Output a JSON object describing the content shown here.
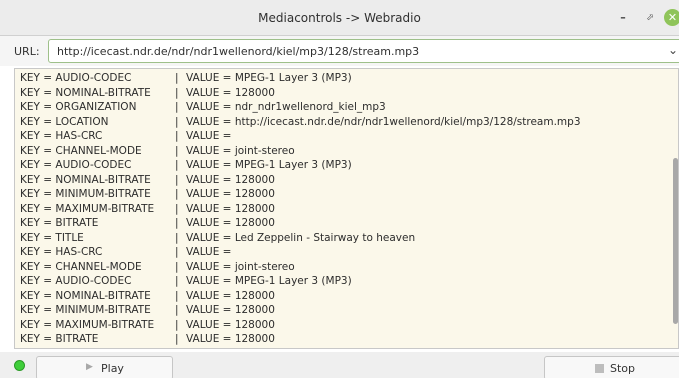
{
  "window": {
    "title": "Mediacontrols -> Webradio",
    "minimize_glyph": "–",
    "maximize_glyph": "⬀",
    "close_glyph": "⊗"
  },
  "url_bar": {
    "label": "URL:",
    "value": "http://icecast.ndr.de/ndr/ndr1wellenord/kiel/mp3/128/stream.mp3",
    "dropdown_glyph": "⌄"
  },
  "metadata": {
    "separator": "|",
    "rows": [
      {
        "key": "KEY = AUDIO-CODEC",
        "value": "VALUE = MPEG-1 Layer 3 (MP3)"
      },
      {
        "key": "KEY = NOMINAL-BITRATE",
        "value": "VALUE = 128000"
      },
      {
        "key": "KEY = ORGANIZATION",
        "value": "VALUE = ndr_ndr1wellenord_kiel_mp3"
      },
      {
        "key": "KEY = LOCATION",
        "value": "VALUE = http://icecast.ndr.de/ndr/ndr1wellenord/kiel/mp3/128/stream.mp3"
      },
      {
        "key": "KEY = HAS-CRC",
        "value": "VALUE ="
      },
      {
        "key": "KEY = CHANNEL-MODE",
        "value": "VALUE = joint-stereo"
      },
      {
        "key": "KEY = AUDIO-CODEC",
        "value": "VALUE = MPEG-1 Layer 3 (MP3)"
      },
      {
        "key": "KEY = NOMINAL-BITRATE",
        "value": "VALUE = 128000"
      },
      {
        "key": "KEY = MINIMUM-BITRATE",
        "value": "VALUE = 128000"
      },
      {
        "key": "KEY = MAXIMUM-BITRATE",
        "value": "VALUE = 128000"
      },
      {
        "key": "KEY = BITRATE",
        "value": "VALUE = 128000"
      },
      {
        "key": "KEY = TITLE",
        "value": "VALUE = Led Zeppelin - Stairway to heaven"
      },
      {
        "key": "KEY = HAS-CRC",
        "value": "VALUE ="
      },
      {
        "key": "KEY = CHANNEL-MODE",
        "value": "VALUE = joint-stereo"
      },
      {
        "key": "KEY = AUDIO-CODEC",
        "value": "VALUE = MPEG-1 Layer 3 (MP3)"
      },
      {
        "key": "KEY = NOMINAL-BITRATE",
        "value": "VALUE = 128000"
      },
      {
        "key": "KEY = MINIMUM-BITRATE",
        "value": "VALUE = 128000"
      },
      {
        "key": "KEY = MAXIMUM-BITRATE",
        "value": "VALUE = 128000"
      },
      {
        "key": "KEY = BITRATE",
        "value": "VALUE = 128000"
      }
    ]
  },
  "controls": {
    "status_color": "#3fce3a",
    "play_label": "Play",
    "play_icon": "play-icon",
    "stop_label": "Stop",
    "stop_icon": "stop-icon"
  }
}
